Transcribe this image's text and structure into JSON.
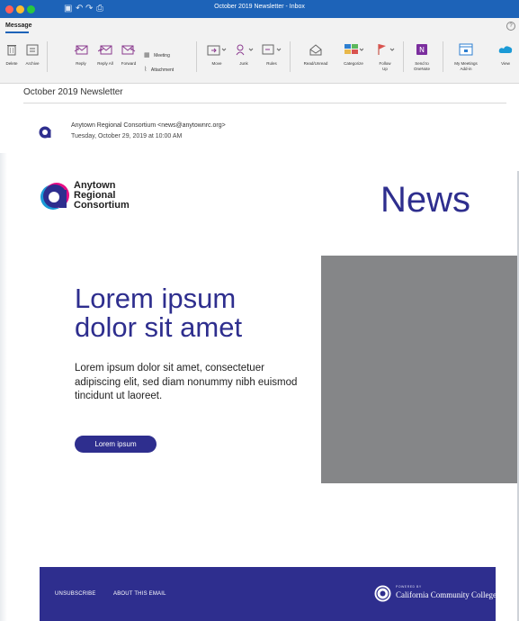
{
  "window": {
    "title": "October 2019 Newsletter - Inbox",
    "colors": {
      "titlebar": "#1d63b8",
      "close": "#ff5f57",
      "minimize": "#febc2e",
      "zoom": "#28c840"
    }
  },
  "ribbon": {
    "tab": "Message",
    "buttons": {
      "delete": "Delete",
      "archive": "Archive",
      "reply": "Reply",
      "reply_all": "Reply All",
      "forward": "Forward",
      "meeting": "Meeting",
      "attachment": "Attachment",
      "move": "Move",
      "junk": "Junk",
      "rules": "Rules",
      "read_unread": "Read/Unread",
      "categorize": "Categorize",
      "follow_up": "Follow Up",
      "send_to_onenote": "Send to OneNote",
      "my_meetings": "My Meetings Add-in",
      "view": "View"
    }
  },
  "message": {
    "subject": "October 2019 Newsletter",
    "sender": "Anytown Regional Consortium <news@anytownrc.org>",
    "date": "Tuesday, October 29, 2019 at 10:00 AM"
  },
  "newsletter": {
    "brand_lines": [
      "Anytown",
      "Regional",
      "Consortium"
    ],
    "heading": "News",
    "hero_title_lines": [
      "Lorem ipsum",
      "dolor sit amet"
    ],
    "hero_body": "Lorem ipsum dolor sit amet, consectetuer adipiscing elit, sed diam nonummy nibh euismod tincidunt ut laoreet.",
    "cta_label": "Lorem ipsum",
    "colors": {
      "brand_navy": "#2e2e8e",
      "brand_blue": "#1b9ad6",
      "brand_magenta": "#e5007e",
      "image_placeholder": "#858688"
    }
  },
  "footer": {
    "unsubscribe": "UNSUBSCRIBE",
    "about": "ABOUT THIS EMAIL",
    "powered_by": "POWERED BY",
    "partner": "California Community Colleges"
  }
}
